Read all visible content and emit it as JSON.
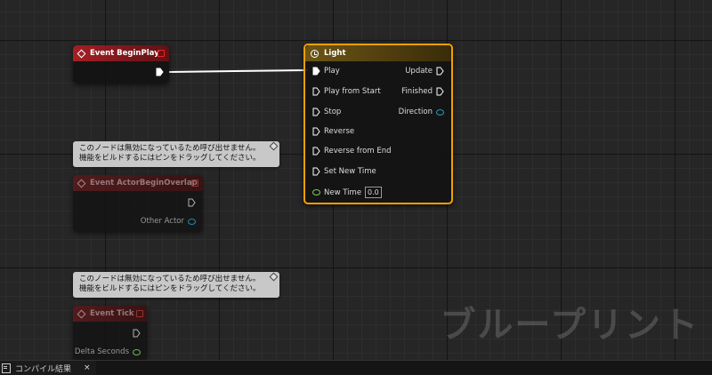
{
  "nodes": {
    "begin_play": {
      "title": "Event BeginPlay"
    },
    "light_timeline": {
      "title": "Light",
      "inputs": [
        "Play",
        "Play from Start",
        "Stop",
        "Reverse",
        "Reverse from End",
        "Set New Time"
      ],
      "outputs": [
        "Update",
        "Finished",
        "Direction"
      ],
      "new_time_label": "New Time",
      "new_time_value": "0.0"
    },
    "actor_begin_overlap": {
      "title": "Event ActorBeginOverlap",
      "output_other_actor": "Other Actor"
    },
    "event_tick": {
      "title": "Event Tick",
      "output_delta_seconds": "Delta Seconds"
    }
  },
  "comments": {
    "overlap_disabled": "このノードは無効になっているため呼び出せません。\n機能をビルドするにはピンをドラッグしてください。",
    "tick_disabled": "このノードは無効になっているため呼び出せません。\n機能をビルドするにはピンをドラッグしてください。"
  },
  "watermark": "ブループリント",
  "tabs": {
    "compile_results": "コンパイル結果",
    "close": "×"
  },
  "colors": {
    "event_header": "#a41f25",
    "timeline_header": "#6d5514",
    "selection_outline": "#f0a000",
    "object_pin": "#1ea0c8",
    "float_pin": "#7cd25a"
  }
}
